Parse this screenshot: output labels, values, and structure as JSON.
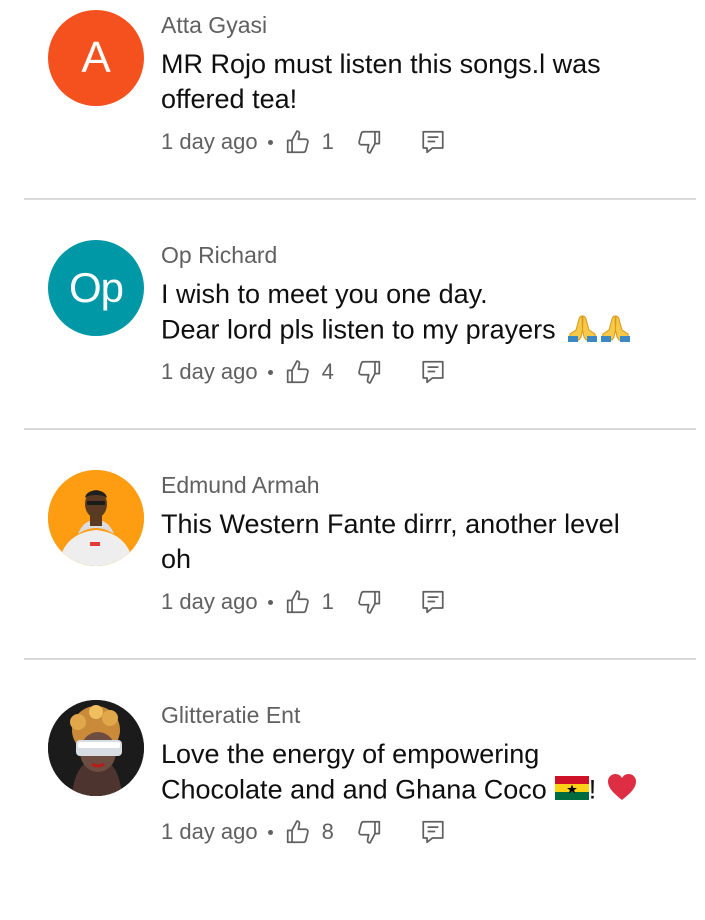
{
  "comments": [
    {
      "author": "Atta Gyasi",
      "avatar_letter": "A",
      "avatar_color": "#f4511e",
      "lines": [
        "MR  Rojo must listen this songs.l was",
        "offered tea!"
      ],
      "time": "1 day ago",
      "likes": "1"
    },
    {
      "author": "Op Richard",
      "avatar_letter": "Op",
      "avatar_color": "#0097a7",
      "lines": [
        "I wish to meet you one day.",
        "Dear lord pls listen to my prayers"
      ],
      "emoji": [
        "folded-hands",
        "folded-hands"
      ],
      "time": "1 day ago",
      "likes": "4"
    },
    {
      "author": "Edmund Armah",
      "avatar_color": "#ff9800",
      "lines": [
        "This Western Fante dirrr, another level",
        "oh"
      ],
      "time": "1 day ago",
      "likes": "1"
    },
    {
      "author": "Glitteratie Ent",
      "lines": [
        "Love the energy of empowering",
        "Chocolate and and Ghana Coco"
      ],
      "line2_suffix": "!",
      "emoji": [
        "ghana-flag",
        "red-heart"
      ],
      "time": "1 day ago",
      "likes": "8"
    }
  ]
}
